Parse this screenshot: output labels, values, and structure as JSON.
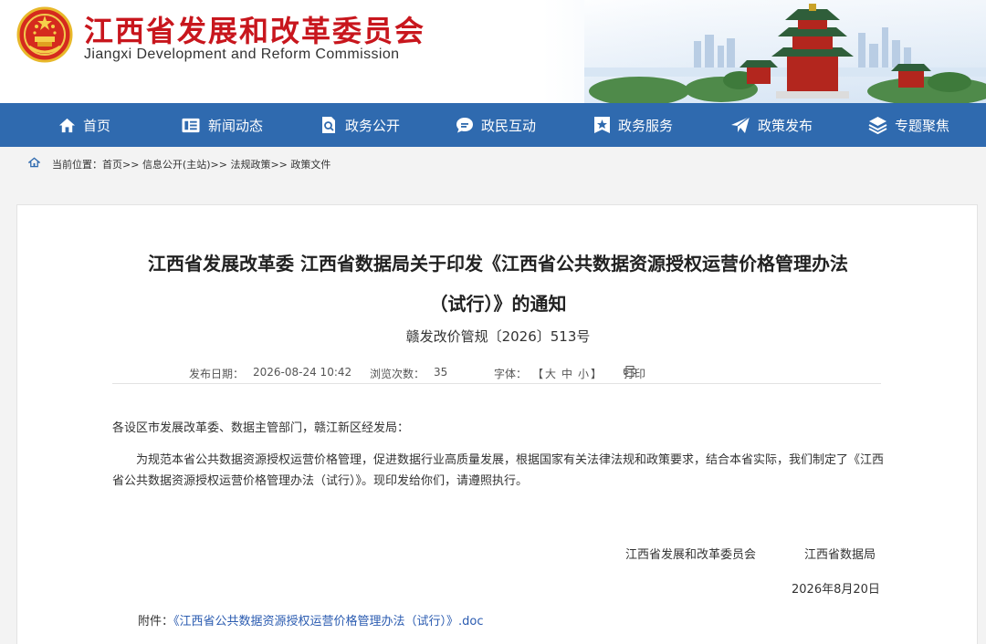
{
  "header": {
    "title": "江西省发展和改革委员会",
    "subtitle": "Jiangxi Development and Reform Commission"
  },
  "nav": [
    {
      "label": "首页",
      "icon": "home-icon"
    },
    {
      "label": "新闻动态",
      "icon": "news-icon"
    },
    {
      "label": "政务公开",
      "icon": "document-search-icon"
    },
    {
      "label": "政民互动",
      "icon": "chat-icon"
    },
    {
      "label": "政务服务",
      "icon": "star-badge-icon"
    },
    {
      "label": "政策发布",
      "icon": "paper-plane-icon"
    },
    {
      "label": "专题聚焦",
      "icon": "layers-icon"
    }
  ],
  "breadcrumb": {
    "prefix": "当前位置：",
    "items": [
      "首页",
      "信息公开(主站)",
      "法规政策",
      "政策文件"
    ],
    "separator": ">>"
  },
  "article": {
    "title_line1": "江西省发展改革委 江西省数据局关于印发《江西省公共数据资源授权运营价格管理办法",
    "title_line2": "（试行）》的通知",
    "doc_number": "赣发改价管规〔2026〕513号",
    "meta": {
      "publish_label": "发布日期：",
      "publish_date": "2026-08-24 10:42",
      "views_label": "浏览次数：",
      "views": "35",
      "font_label": "字体：",
      "font_open": "【",
      "font_large": "大",
      "font_medium": "中",
      "font_small": "小",
      "font_close": "】",
      "print_label": "打印"
    },
    "salutation": "各设区市发展改革委、数据主管部门，赣江新区经发局：",
    "paragraph": "为规范本省公共数据资源授权运营价格管理，促进数据行业高质量发展，根据国家有关法律法规和政策要求，结合本省实际，我们制定了《江西省公共数据资源授权运营价格管理办法（试行）》。现印发给你们，请遵照执行。",
    "signers": [
      "江西省发展和改革委员会",
      "江西省数据局"
    ],
    "date": "2026年8月20日",
    "attachment_label": "附件：",
    "attachment_link": "《江西省公共数据资源授权运营价格管理办法（试行）》.doc"
  },
  "colors": {
    "brand_red": "#c8161d",
    "nav_blue": "#2f6aaf",
    "link_blue": "#2a5bb0"
  }
}
